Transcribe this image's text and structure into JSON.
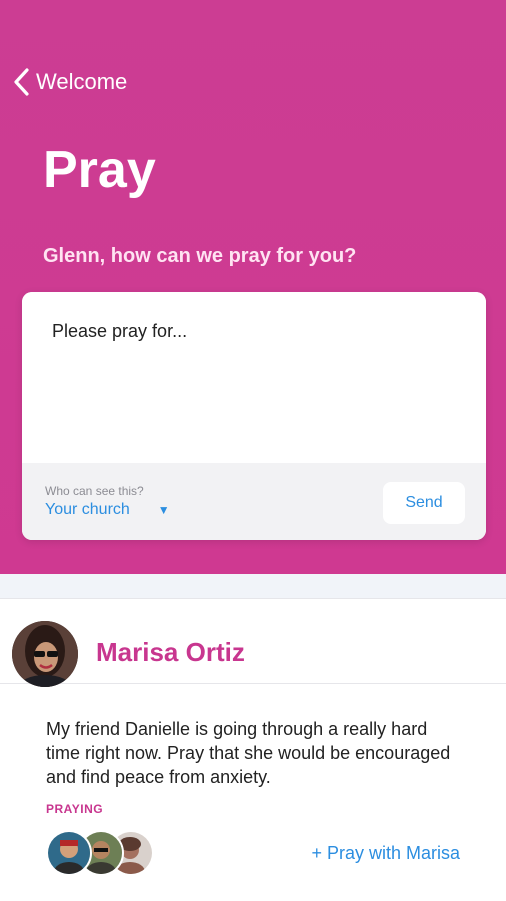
{
  "nav": {
    "back_label": "Welcome"
  },
  "page": {
    "title": "Pray",
    "prompt": "Glenn, how can we pray for you?"
  },
  "compose": {
    "placeholder": "Please pray for...",
    "visibility_label": "Who can see this?",
    "visibility_value": "Your church",
    "send_label": "Send"
  },
  "post": {
    "author": "Marisa Ortiz",
    "text": "My friend Danielle is going through a really hard time right now. Pray that she would be encouraged and find peace from anxiety.",
    "praying_label": "PRAYING",
    "pray_with_label": "+ Pray with Marisa"
  },
  "colors": {
    "brand": "#cc3d93",
    "accent_blue": "#2c8ee0",
    "author_pink": "#c8368f"
  }
}
